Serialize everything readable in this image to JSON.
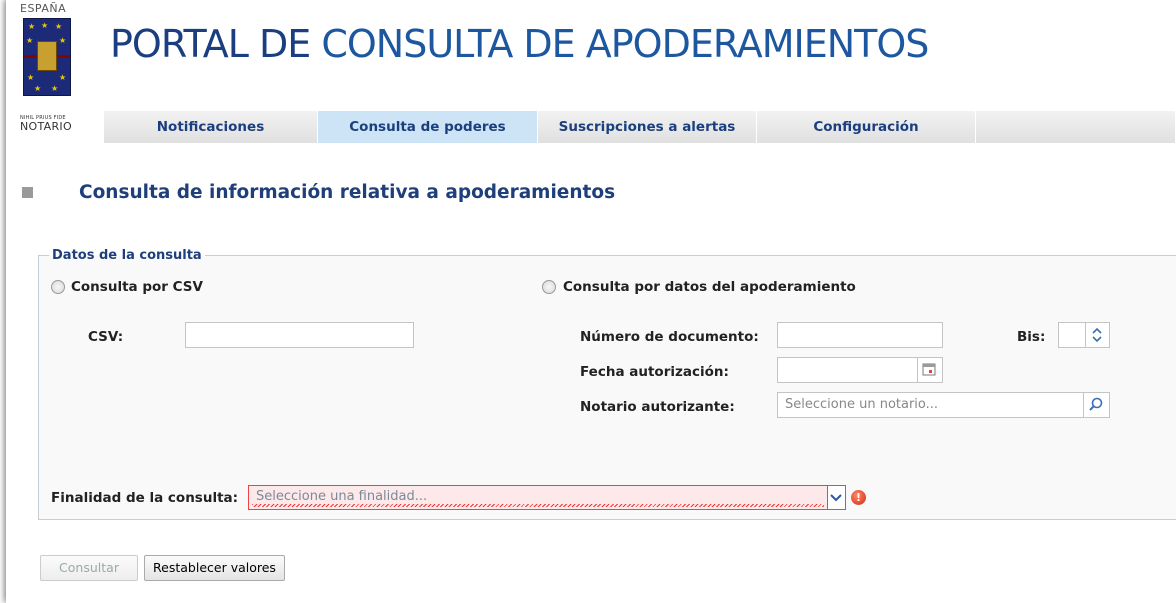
{
  "header": {
    "logo_country": "ESPAÑA",
    "logo_motto": "NIHIL PRIUS FIDE",
    "logo_brand": "NOTARIO",
    "title_part1": "PORTAL DE ",
    "title_part2": "CONSULTA DE APODERAMIENTOS"
  },
  "nav": {
    "tabs": [
      {
        "label": "Notificaciones"
      },
      {
        "label": "Consulta de poderes"
      },
      {
        "label": "Suscripciones a alertas"
      },
      {
        "label": "Configuración"
      }
    ],
    "active_tab": "Consulta de poderes"
  },
  "page": {
    "section_title": "Consulta de información relativa a apoderamientos"
  },
  "form": {
    "legend": "Datos de la consulta",
    "radio_csv_label": "Consulta por CSV",
    "radio_datos_label": "Consulta por datos del apoderamiento",
    "csv_label": "CSV:",
    "csv_value": "",
    "numero_label": "Número de documento:",
    "numero_value": "",
    "bis_label": "Bis:",
    "bis_value": "",
    "fecha_label": "Fecha autorización:",
    "fecha_value": "",
    "notario_label": "Notario autorizante:",
    "notario_placeholder": "Seleccione un notario...",
    "finalidad_label": "Finalidad de la consulta:",
    "finalidad_placeholder": "Seleccione una finalidad..."
  },
  "actions": {
    "consultar_label": "Consultar",
    "restablecer_label": "Restablecer valores"
  },
  "colors": {
    "accent": "#1f3f7a",
    "active_tab": "#cde4f6",
    "error": "#e44444"
  }
}
